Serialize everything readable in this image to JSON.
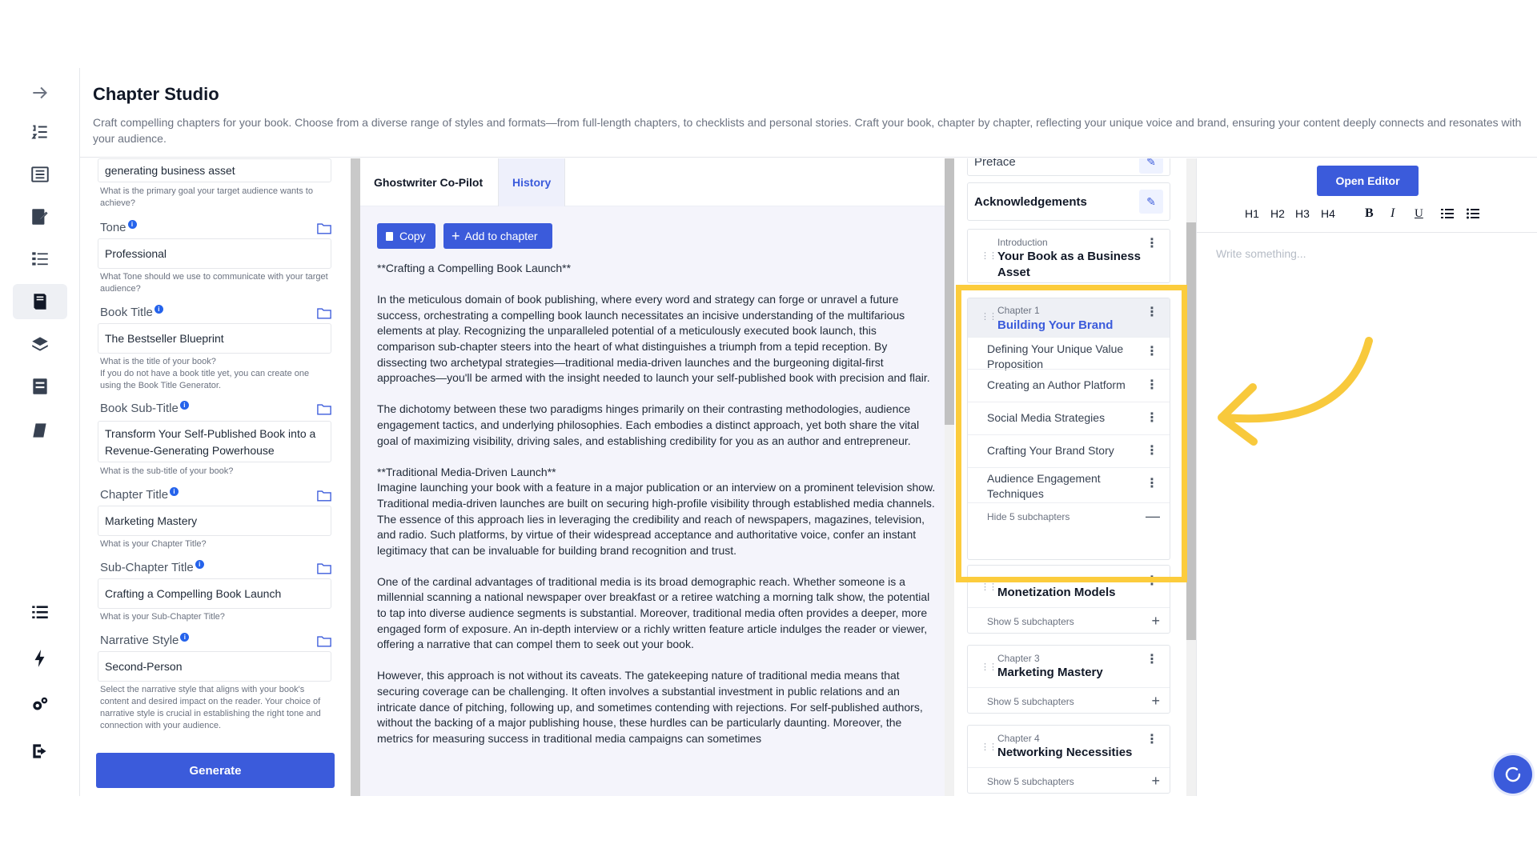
{
  "header": {
    "title": "Chapter Studio",
    "description": "Craft compelling chapters for your book. Choose from a diverse range of styles and formats—from full-length chapters, to checklists and personal stories. Craft your book, chapter by chapter, reflecting your unique voice and brand, ensuring your content deeply connects and resonates with your audience."
  },
  "form": {
    "goal_value": "generating business asset",
    "goal_hint": "What is the primary goal your target audience wants to achieve?",
    "tone_label": "Tone",
    "tone_value": "Professional",
    "tone_hint": "What Tone should we use to communicate with your target audience?",
    "book_title_label": "Book Title",
    "book_title_value": "The Bestseller Blueprint",
    "book_title_hint": "What is the title of your book?",
    "book_title_hint2": "If you do not have a book title yet, you can create one using the Book Title Generator.",
    "book_subtitle_label": "Book Sub-Title",
    "book_subtitle_value": "Transform Your Self-Published Book into a Revenue-Generating Powerhouse",
    "book_subtitle_hint": "What is the sub-title of your book?",
    "chapter_title_label": "Chapter Title",
    "chapter_title_value": "Marketing Mastery",
    "chapter_title_hint": "What is your Chapter Title?",
    "subchapter_title_label": "Sub-Chapter Title",
    "subchapter_title_value": "Crafting a Compelling Book Launch",
    "subchapter_title_hint": "What is your Sub-Chapter Title?",
    "narrative_label": "Narrative Style",
    "narrative_value": "Second-Person",
    "narrative_hint": "Select the narrative style that aligns with your book's content and desired impact on the reader. Your choice of narrative style is crucial in establishing the right tone and connection with your audience.",
    "generate_label": "Generate",
    "info_glyph": "i"
  },
  "content": {
    "tab_copilot": "Ghostwriter Co-Pilot",
    "tab_history": "History",
    "copy_label": "Copy",
    "add_label": "Add to chapter",
    "heading1": "**Crafting a Compelling Book Launch**",
    "para1": "In the meticulous domain of book publishing, where every word and strategy can forge or unravel a future success, orchestrating a compelling book launch necessitates an incisive understanding of the multifarious elements at play. Recognizing the unparalleled potential of a meticulously executed book launch, this comparison sub-chapter steers into the heart of what distinguishes a triumph from a tepid reception. By dissecting two archetypal strategies—traditional media-driven launches and the burgeoning digital-first approaches—you'll be armed with the insight needed to launch your self-published book with precision and flair.",
    "para2": "The dichotomy between these two paradigms hinges primarily on their contrasting methodologies, audience engagement tactics, and underlying philosophies. Each embodies a distinct approach, yet both share the vital goal of maximizing visibility, driving sales, and establishing credibility for you as an author and entrepreneur.",
    "heading2": "**Traditional Media-Driven Launch**",
    "para3": "Imagine launching your book with a feature in a major publication or an interview on a prominent television show. Traditional media-driven launches are built on securing high-profile visibility through established media channels. The essence of this approach lies in leveraging the credibility and reach of newspapers, magazines, television, and radio. Such platforms, by virtue of their widespread acceptance and authoritative voice, confer an instant legitimacy that can be invaluable for building brand recognition and trust.",
    "para4": "One of the cardinal advantages of traditional media is its broad demographic reach. Whether someone is a millennial scanning a national newspaper over breakfast or a retiree watching a morning talk show, the potential to tap into diverse audience segments is substantial. Moreover, traditional media often provides a deeper, more engaged form of exposure. An in-depth interview or a richly written feature article indulges the reader or viewer, offering a narrative that can compel them to seek out your book.",
    "para5": "However, this approach is not without its caveats. The gatekeeping nature of traditional media means that securing coverage can be challenging. It often involves a substantial investment in public relations and an intricate dance of pitching, following up, and sometimes contending with rejections. For self-published authors, without the backing of a major publishing house, these hurdles can be particularly daunting. Moreover, the metrics for measuring success in traditional media campaigns can sometimes"
  },
  "chapters": {
    "preface": "Preface",
    "acknowledgements": "Acknowledgements",
    "intro_caption": "Introduction",
    "intro_title": "Your Book as a Business Asset",
    "ch1_caption": "Chapter 1",
    "ch1_title": "Building Your Brand",
    "ch1_subs": [
      "Defining Your Unique Value Proposition",
      "Creating an Author Platform",
      "Social Media Strategies",
      "Crafting Your Brand Story",
      "Audience Engagement Techniques"
    ],
    "ch1_toggle": "Hide 5 subchapters",
    "ch2_title": "Monetization Models",
    "ch2_toggle": "Show 5 subchapters",
    "ch3_caption": "Chapter 3",
    "ch3_title": "Marketing Mastery",
    "ch3_toggle": "Show 5 subchapters",
    "ch4_caption": "Chapter 4",
    "ch4_title": "Networking Necessities",
    "ch4_toggle": "Show 5 subchapters"
  },
  "editor": {
    "open_label": "Open Editor",
    "h1": "H1",
    "h2": "H2",
    "h3": "H3",
    "h4": "H4",
    "bold": "B",
    "italic": "I",
    "underline": "U",
    "placeholder": "Write something..."
  },
  "colors": {
    "accent": "#3b5bdb",
    "highlight": "#fccc3c",
    "arrow": "#f8c93c"
  }
}
